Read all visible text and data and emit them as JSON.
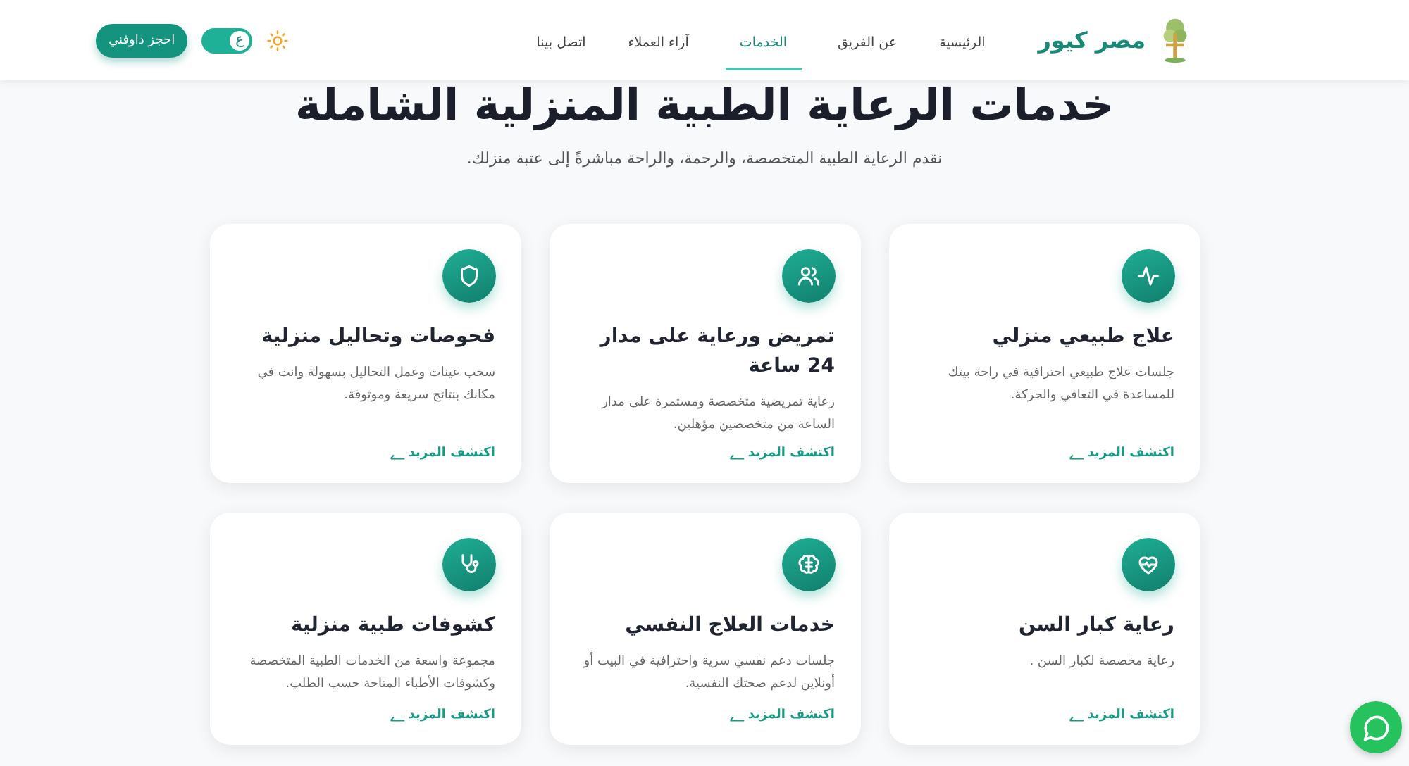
{
  "header": {
    "brand": "مصر كيور",
    "nav": [
      {
        "label": "الرئيسية",
        "selected": false
      },
      {
        "label": "عن الفريق",
        "selected": false
      },
      {
        "label": "الخدمات",
        "selected": true
      },
      {
        "label": "آراء العملاء",
        "selected": false
      },
      {
        "label": "اتصل بينا",
        "selected": false
      }
    ],
    "language_toggle": {
      "label": "ع"
    },
    "book_button": "احجز داوفني"
  },
  "hero": {
    "title": "خدمات الرعاية الطبية المنزلية الشاملة",
    "subtitle": "نقدم الرعاية الطبية المتخصصة، والرحمة، والراحة مباشرةً إلى عتبة منزلك."
  },
  "services": [
    {
      "title": "علاج طبيعي منزلي",
      "description": "جلسات علاج طبيعي احترافية في راحة بيتك للمساعدة في التعافي والحركة.",
      "link": "اكتشف المزيد"
    },
    {
      "title": "تمريض ورعاية على مدار 24 ساعة",
      "description": "رعاية تمريضية متخصصة ومستمرة على مدار الساعة من متخصصين مؤهلين.",
      "link": "اكتشف المزيد"
    },
    {
      "title": "فحوصات وتحاليل منزلية",
      "description": "سحب عينات وعمل التحاليل بسهولة وانت في مكانك بنتائج سريعة وموثوقة.",
      "link": "اكتشف المزيد"
    },
    {
      "title": "رعاية كبار السن",
      "description": "رعاية مخصصة لكبار السن .",
      "link": "اكتشف المزيد"
    },
    {
      "title": "خدمات العلاج النفسي",
      "description": "جلسات دعم نفسي سرية واحترافية في البيت أو أونلاين لدعم صحتك النفسية.",
      "link": "اكتشف المزيد"
    },
    {
      "title": "كشوفات طبية منزلية",
      "description": "مجموعة واسعة من الخدمات الطبية المتخصصة وكشوفات الأطباء المتاحة حسب الطلب.",
      "link": "اكتشف المزيد"
    }
  ]
}
